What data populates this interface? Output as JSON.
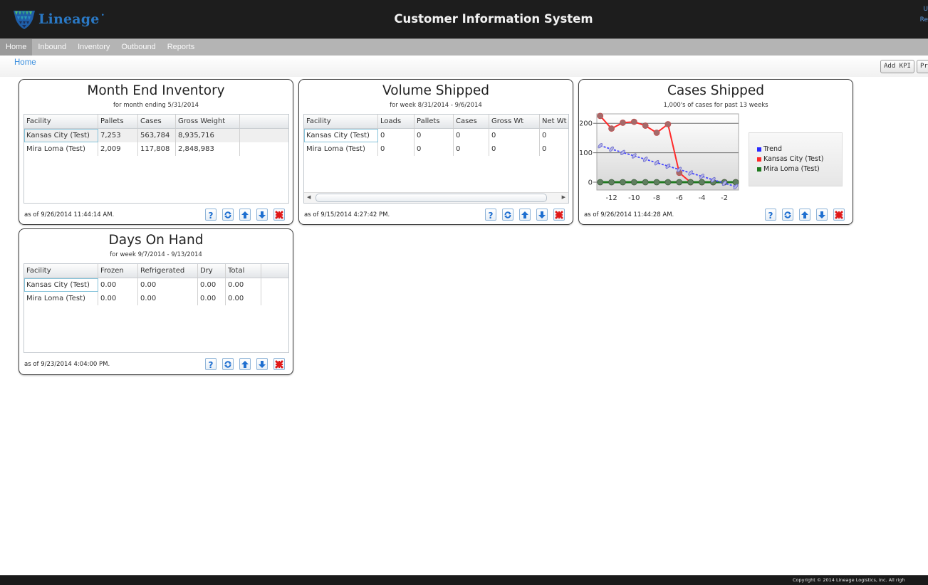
{
  "header": {
    "logo_text": "Lineage",
    "title": "Customer Information System",
    "user_links": [
      "U",
      "Re"
    ]
  },
  "nav": {
    "tabs": [
      {
        "label": "Home",
        "active": true
      },
      {
        "label": "Inbound",
        "active": false
      },
      {
        "label": "Inventory",
        "active": false
      },
      {
        "label": "Outbound",
        "active": false
      },
      {
        "label": "Reports",
        "active": false
      }
    ]
  },
  "breadcrumb": {
    "home": "Home"
  },
  "toolbar": {
    "add_kpi": "Add KPI",
    "second_button": "Pr"
  },
  "panel_buttons": {
    "icons": [
      "help-icon",
      "refresh-icon",
      "move-up-icon",
      "move-down-icon",
      "remove-icon"
    ]
  },
  "panels": {
    "month_end_inventory": {
      "title": "Month End Inventory",
      "subtitle": "for month ending 5/31/2014",
      "columns": [
        "Facility",
        "Pallets",
        "Cases",
        "Gross Weight"
      ],
      "rows": [
        [
          "Kansas City (Test)",
          "7,253",
          "563,784",
          "8,935,716"
        ],
        [
          "Mira Loma (Test)",
          "2,009",
          "117,808",
          "2,848,983"
        ]
      ],
      "as_of": "as of 9/26/2014 11:44:14 AM."
    },
    "volume_shipped": {
      "title": "Volume Shipped",
      "subtitle": "for week 8/31/2014 - 9/6/2014",
      "columns": [
        "Facility",
        "Loads",
        "Pallets",
        "Cases",
        "Gross Wt",
        "Net Wt"
      ],
      "rows": [
        [
          "Kansas City (Test)",
          "0",
          "0",
          "0",
          "0",
          "0"
        ],
        [
          "Mira Loma (Test)",
          "0",
          "0",
          "0",
          "0",
          "0"
        ]
      ],
      "as_of": "as of 9/15/2014 4:27:42 PM."
    },
    "cases_shipped": {
      "as_of": "as of 9/26/2014 11:44:28 AM."
    },
    "days_on_hand": {
      "title": "Days On Hand",
      "subtitle": "for week 9/7/2014 - 9/13/2014",
      "columns": [
        "Facility",
        "Frozen",
        "Refrigerated",
        "Dry",
        "Total"
      ],
      "rows": [
        [
          "Kansas City (Test)",
          "0.00",
          "0.00",
          "0.00",
          "0.00"
        ],
        [
          "Mira Loma (Test)",
          "0.00",
          "0.00",
          "0.00",
          "0.00"
        ]
      ],
      "as_of": "as of 9/23/2014 4:04:00 PM."
    }
  },
  "colors": {
    "header_bg": "#1d1d1d",
    "nav_bg": "#b4b4b4",
    "nav_active_bg": "#9a9a9a",
    "link": "#3b8fde",
    "logo": "#2a78c4"
  },
  "footer": {
    "copyright": "Copyright © 2014 Lineage Logistics, Inc. All righ"
  },
  "chart_data": {
    "type": "line",
    "title": "Cases Shipped",
    "subtitle": "1,000's of cases for past 13 weeks",
    "xlabel": "",
    "ylabel": "",
    "x": [
      -13,
      -12,
      -11,
      -10,
      -9,
      -8,
      -7,
      -6,
      -5,
      -4,
      -3,
      -2,
      -1
    ],
    "xticks": [
      -12,
      -10,
      -8,
      -6,
      -4,
      -2
    ],
    "yticks": [
      0,
      100,
      200
    ],
    "xlim": [
      -13.3,
      -0.75
    ],
    "ylim": [
      -26.6,
      232
    ],
    "grid": true,
    "legend_position": "right",
    "series": [
      {
        "name": "Trend",
        "color": "#2a2aff",
        "style": "dashed",
        "values": [
          124,
          112.4,
          100.8,
          89.3,
          77.7,
          66.1,
          54.5,
          42.9,
          31.3,
          19.8,
          8.2,
          -3.4,
          -15
        ]
      },
      {
        "name": "Kansas City (Test)",
        "color": "#ff2a2a",
        "style": "solid",
        "values": [
          225,
          182,
          202,
          205,
          192,
          168,
          197,
          32,
          0,
          0,
          0,
          0,
          0
        ]
      },
      {
        "name": "Mira Loma (Test)",
        "color": "#1f7a1f",
        "style": "solid",
        "values": [
          0,
          0,
          0,
          0,
          0,
          0,
          0,
          0,
          0,
          0,
          0,
          0,
          0
        ]
      }
    ]
  }
}
